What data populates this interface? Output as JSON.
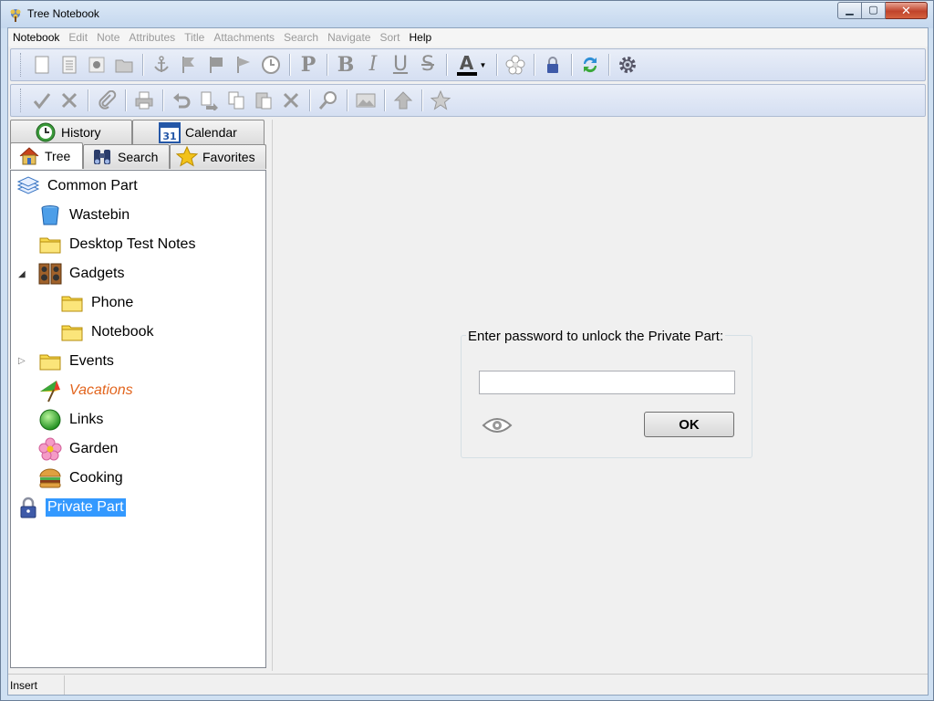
{
  "window": {
    "title": "Tree Notebook",
    "min_label": "▁",
    "max_label": "▢",
    "close_label": "✕"
  },
  "menu": [
    {
      "label": "Notebook",
      "enabled": true
    },
    {
      "label": "Edit",
      "enabled": false
    },
    {
      "label": "Note",
      "enabled": false
    },
    {
      "label": "Attributes",
      "enabled": false
    },
    {
      "label": "Title",
      "enabled": false
    },
    {
      "label": "Attachments",
      "enabled": false
    },
    {
      "label": "Search",
      "enabled": false
    },
    {
      "label": "Navigate",
      "enabled": false
    },
    {
      "label": "Sort",
      "enabled": false
    },
    {
      "label": "Help",
      "enabled": true
    }
  ],
  "toolbar1": {
    "icons": [
      "new-note-icon",
      "new-list-icon",
      "new-bullet-icon",
      "open-folder-icon",
      "anchor-icon",
      "flag-icon",
      "flag-filled-icon",
      "flag-outline-icon",
      "clock-icon",
      "paragraph-icon",
      "bold-icon",
      "italic-icon",
      "underline-icon",
      "strikethrough-icon",
      "font-color-icon",
      "flower-icon",
      "lock-icon",
      "sync-icon",
      "settings-gear-icon"
    ],
    "text_glyphs": {
      "paragraph": "P",
      "bold": "B",
      "italic": "I",
      "underline": "U",
      "strike": "S",
      "font": "A"
    }
  },
  "toolbar2": {
    "icons": [
      "check-icon",
      "cancel-x-icon",
      "attach-paperclip-icon",
      "print-icon",
      "undo-icon",
      "move-note-icon",
      "copy-icon",
      "paste-icon",
      "delete-x-icon",
      "search-magnifier-icon",
      "image-icon",
      "up-arrow-icon",
      "star-icon"
    ]
  },
  "tabs": {
    "history": "History",
    "calendar": "Calendar",
    "calendar_day": "31",
    "tree": "Tree",
    "search": "Search",
    "favorites": "Favorites"
  },
  "tree": [
    {
      "label": "Common Part",
      "icon": "layers-icon",
      "level": 0
    },
    {
      "label": "Wastebin",
      "icon": "bin-icon",
      "level": 1
    },
    {
      "label": "Desktop Test Notes",
      "icon": "folder-icon",
      "level": 1
    },
    {
      "label": "Gadgets",
      "icon": "speakers-icon",
      "level": 1,
      "expanded": true
    },
    {
      "label": "Phone",
      "icon": "folder-icon",
      "level": 2
    },
    {
      "label": "Notebook",
      "icon": "folder-icon",
      "level": 2
    },
    {
      "label": "Events",
      "icon": "folder-icon",
      "level": 1,
      "collapsed": true
    },
    {
      "label": "Vacations",
      "icon": "umbrella-icon",
      "level": 1,
      "style": "italic-orange"
    },
    {
      "label": "Links",
      "icon": "green-ball-icon",
      "level": 1
    },
    {
      "label": "Garden",
      "icon": "flower-icon",
      "level": 1
    },
    {
      "label": "Cooking",
      "icon": "burger-icon",
      "level": 1
    },
    {
      "label": "Private Part",
      "icon": "lock-icon",
      "level": 0,
      "selected": true
    }
  ],
  "password": {
    "title": "Enter password to unlock the Private Part:",
    "value": "",
    "ok_label": "OK"
  },
  "status": {
    "mode": "Insert"
  },
  "colors": {
    "selection": "#3399ff",
    "vacations_text": "#e2651e",
    "toolbar_bg": "#d5dff2"
  }
}
